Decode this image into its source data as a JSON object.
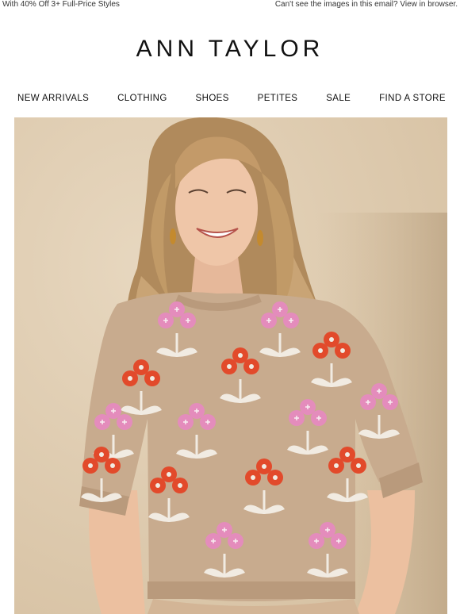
{
  "preheader": {
    "promo_text": "With 40% Off 3+ Full-Price Styles",
    "view_in_browser": "Can't see the images in this email? View in browser."
  },
  "brand": {
    "logo_text": "ANN TAYLOR"
  },
  "nav": {
    "items": [
      {
        "label": "NEW ARRIVALS"
      },
      {
        "label": "CLOTHING"
      },
      {
        "label": "SHOES"
      },
      {
        "label": "PETITES"
      },
      {
        "label": "SALE"
      },
      {
        "label": "FIND A STORE"
      }
    ]
  },
  "hero": {
    "image": "hero-photo-woman-floral-sweater"
  },
  "colors": {
    "wall": "#e2d0b6",
    "sweater": "#c8ab8e",
    "flower_red": "#e24a2b",
    "flower_pink": "#e48cbc",
    "leaf": "#f1ebe2"
  }
}
